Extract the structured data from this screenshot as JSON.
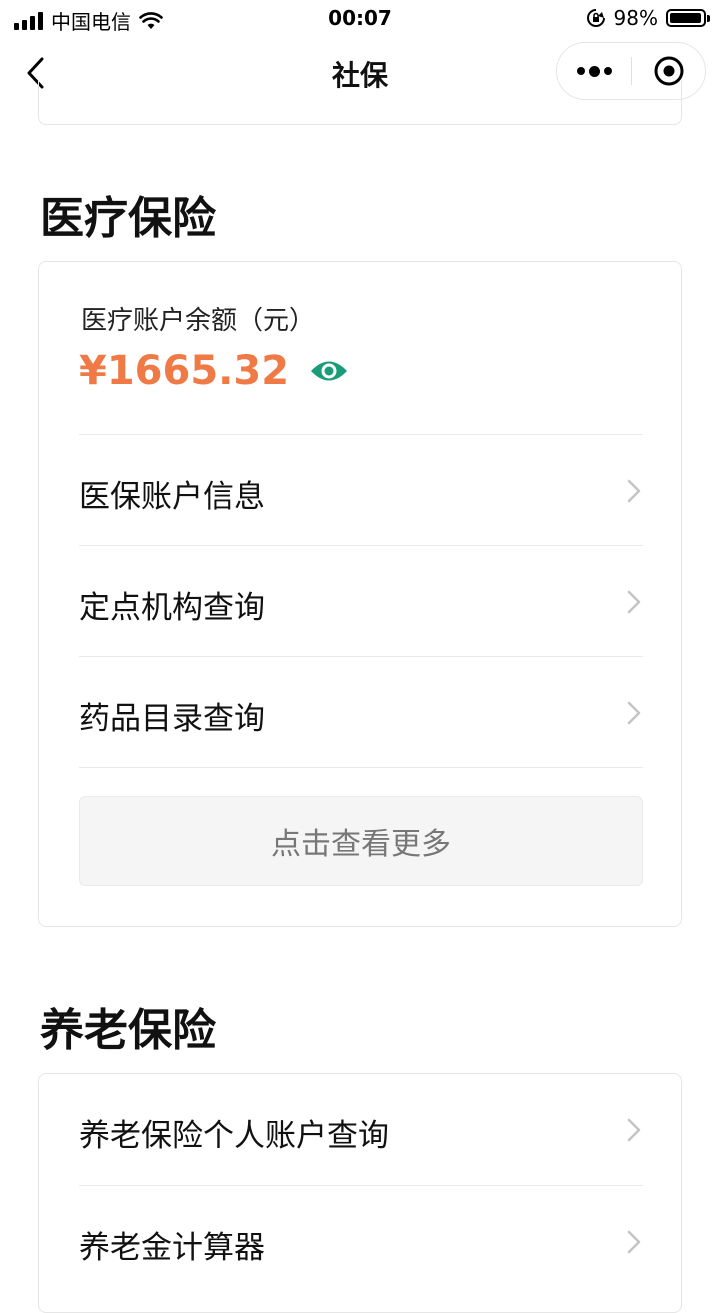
{
  "status_bar": {
    "carrier": "中国电信",
    "time": "00:07",
    "battery": "98%",
    "battery_level": 0.98
  },
  "nav": {
    "title": "社保",
    "icons": [
      "back-arrow-icon",
      "more-dots-icon",
      "close-target-icon"
    ]
  },
  "medical": {
    "title": "医疗保险",
    "balance_label": "医疗账户余额（元）",
    "balance_value": "¥1665.32",
    "items": [
      {
        "label": "医保账户信息"
      },
      {
        "label": "定点机构查询"
      },
      {
        "label": "药品目录查询"
      }
    ],
    "more_label": "点击查看更多"
  },
  "pension": {
    "title": "养老保险",
    "items": [
      {
        "label": "养老保险个人账户查询"
      },
      {
        "label": "养老金计算器"
      }
    ]
  },
  "colors": {
    "accent_orange": "#f07a46",
    "eye_green": "#1a9c7a"
  }
}
